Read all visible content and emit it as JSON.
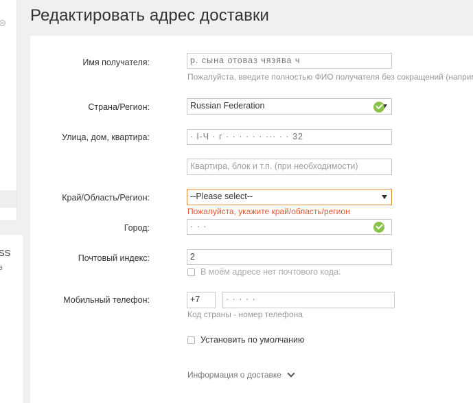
{
  "page": {
    "title": "Редактировать адрес доставки"
  },
  "left_panel": {
    "ss_text": "SS",
    "b_text": "в"
  },
  "form": {
    "recipient": {
      "label": "Имя получателя:",
      "value": "p. сына отоваз чязява ч",
      "hint": "Пожалуйста, введите полностью ФИО получателя без сокращений (например:"
    },
    "country": {
      "label": "Страна/Регион:",
      "value": "Russian Federation"
    },
    "street": {
      "label": "Улица, дом, квартира:",
      "value": "· l-Ч · г · · · · · · ··· · · 32"
    },
    "apartment": {
      "placeholder": "Квартира, блок и т.п. (при необходимости)"
    },
    "region": {
      "label": "Край/Область/Регион:",
      "value": "--Please select--",
      "error": "Пожалуйста, укажите край/область/регион"
    },
    "city": {
      "label": "Город:",
      "value": "· · ·"
    },
    "postal": {
      "label": "Почтовый индекс:",
      "value": "2",
      "no_code_label": "В моём адресе нет почтового кода."
    },
    "phone": {
      "label": "Мобильный телефон:",
      "country_code": "+7",
      "number": "· · · · ·",
      "hint": "Код страны - номер телефона"
    },
    "default": {
      "label": "Установить по умолчанию"
    },
    "info_link": "Информация о доставке"
  },
  "colors": {
    "valid": "#8bc34a",
    "error": "#e0562f",
    "error_border": "#e08b38"
  }
}
